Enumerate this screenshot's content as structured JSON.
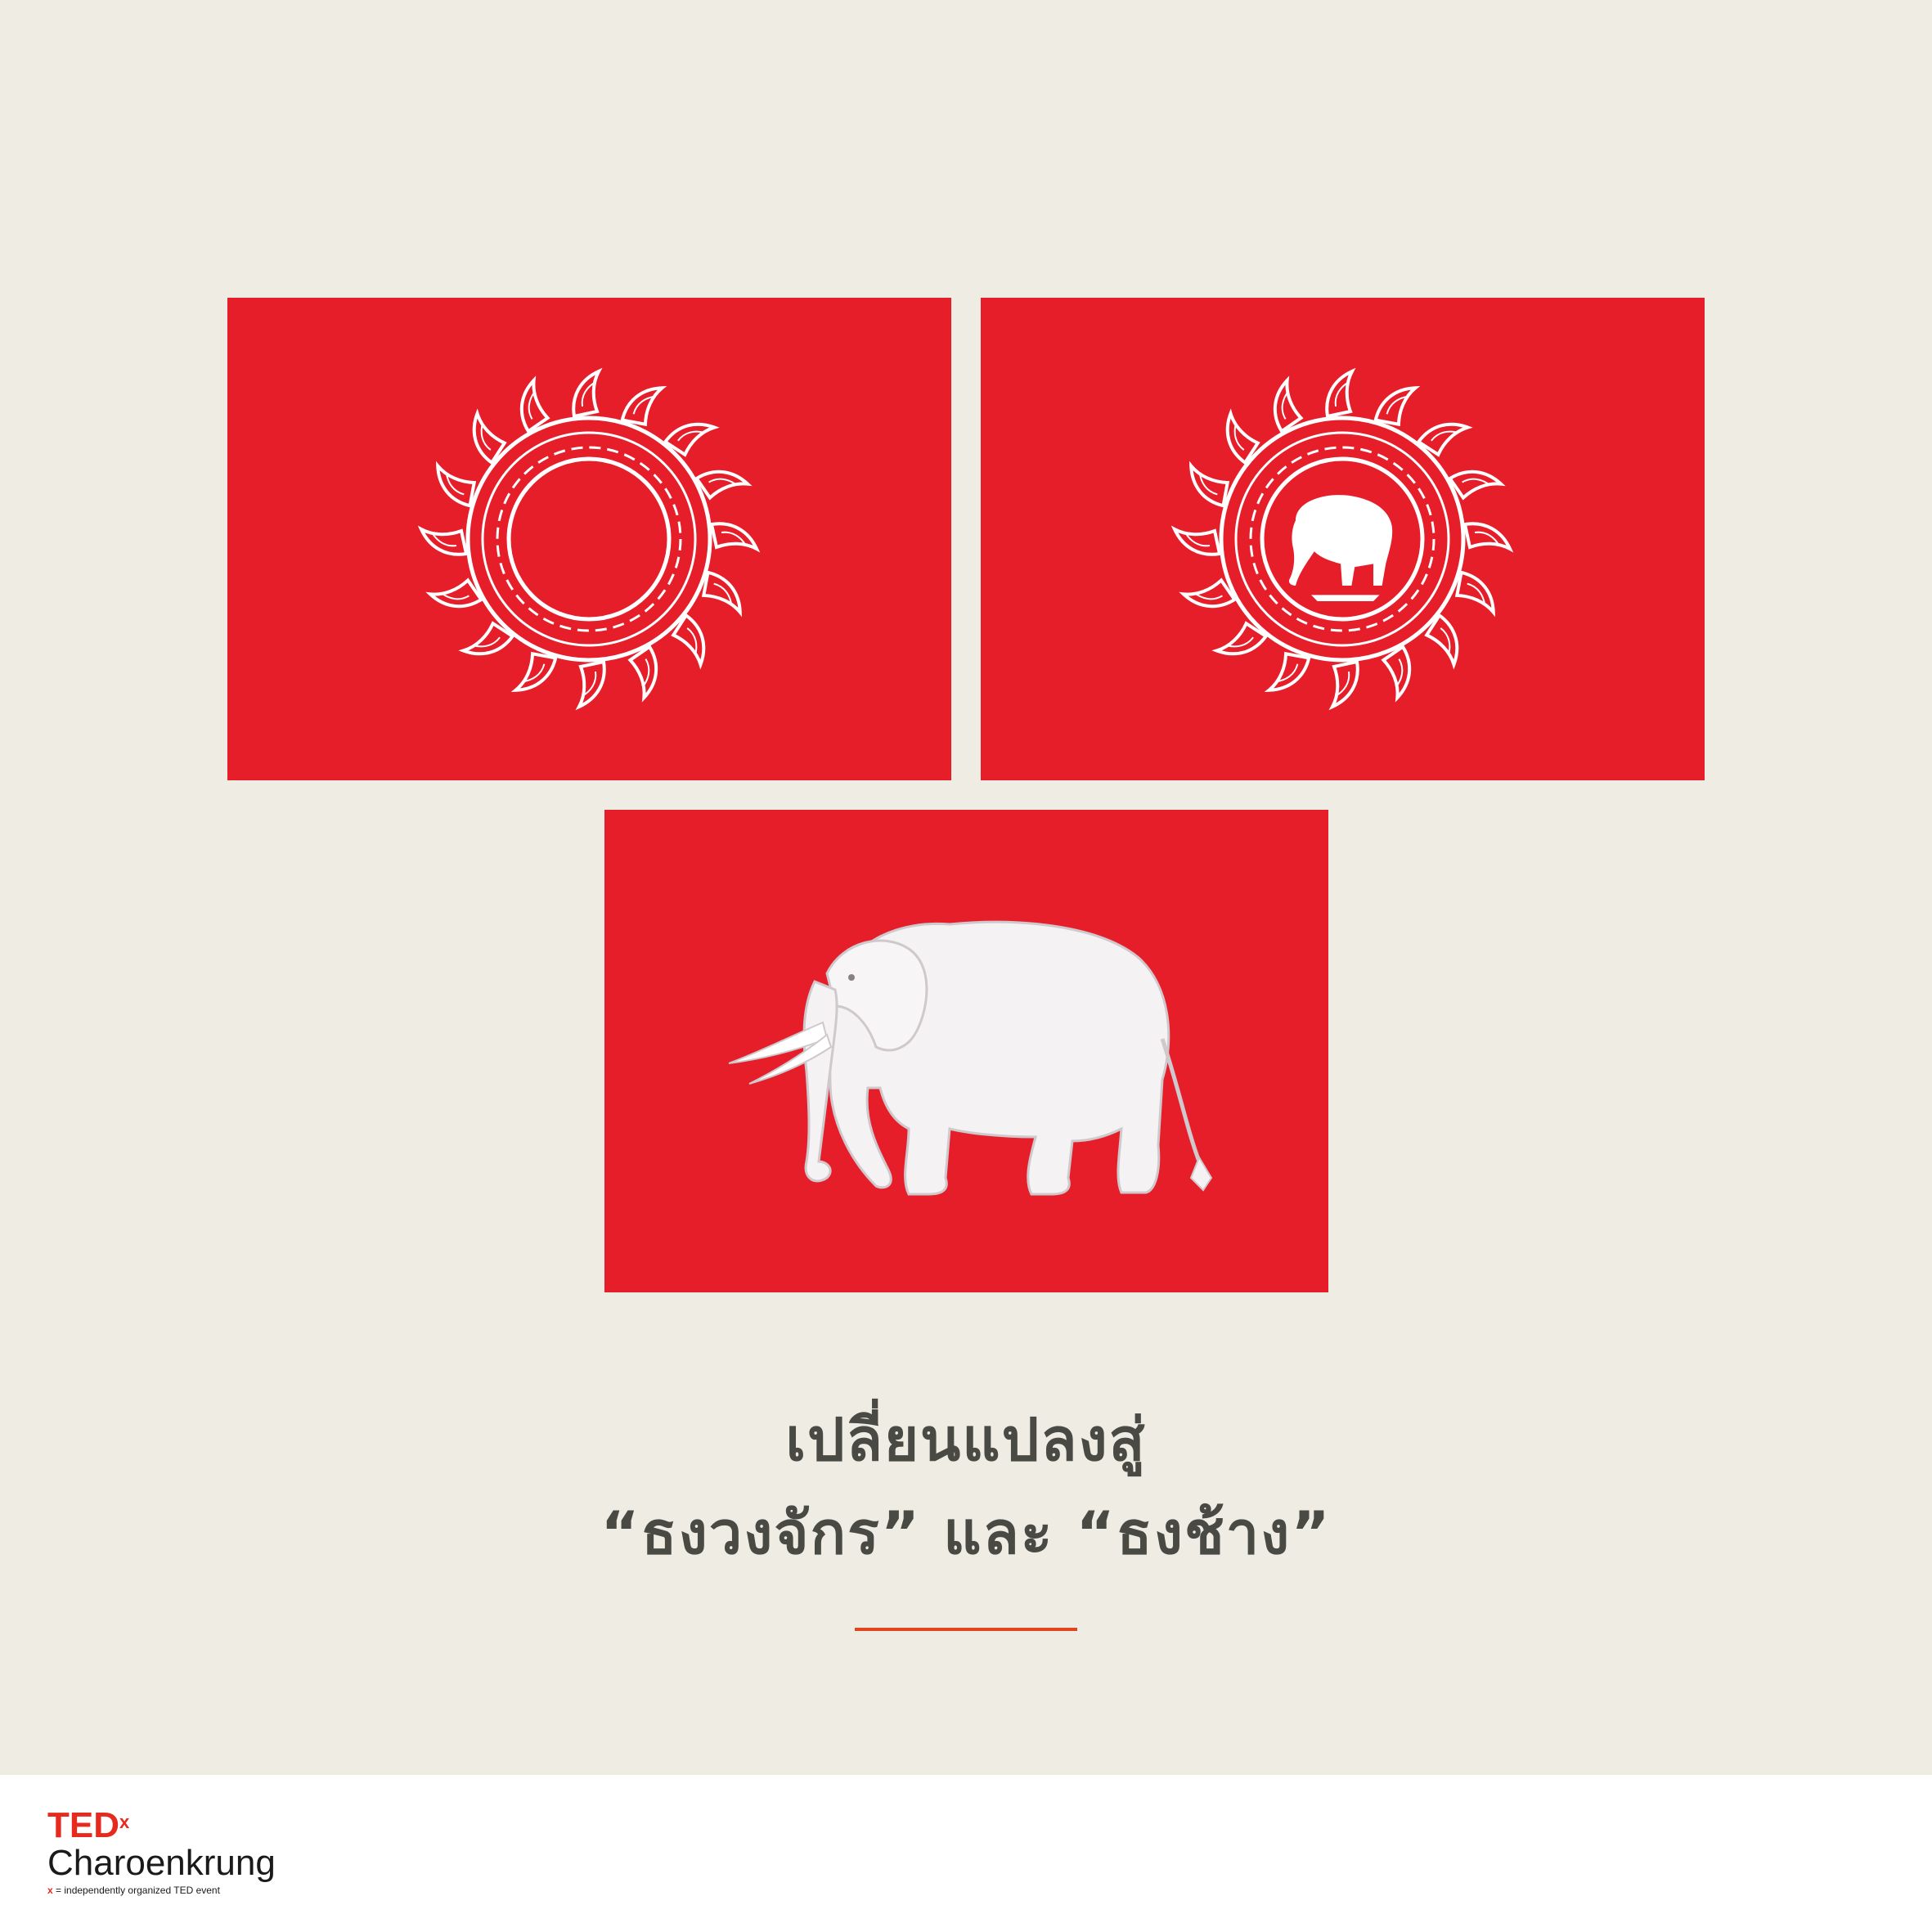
{
  "headline": {
    "line1": "เปลี่ยนแปลงสู่",
    "line2": "“ธงวงจักร” และ “ธงช้าง”"
  },
  "flags": [
    {
      "name": "chakra-flag",
      "emblem": "chakra-wheel"
    },
    {
      "name": "chakra-elephant-flag",
      "emblem": "chakra-wheel-with-elephant"
    },
    {
      "name": "elephant-flag",
      "emblem": "white-elephant"
    }
  ],
  "brand": {
    "ted": "TED",
    "x": "x",
    "name": "Charoenkrung",
    "tag_prefix": "x",
    "tag": " = independently organized TED event"
  },
  "colors": {
    "background": "#efede3",
    "flag_red": "#e61e2a",
    "emblem_white": "#ffffff",
    "text": "#4a4a44",
    "accent_line": "#e1461f",
    "ted_red": "#e62b1e"
  }
}
